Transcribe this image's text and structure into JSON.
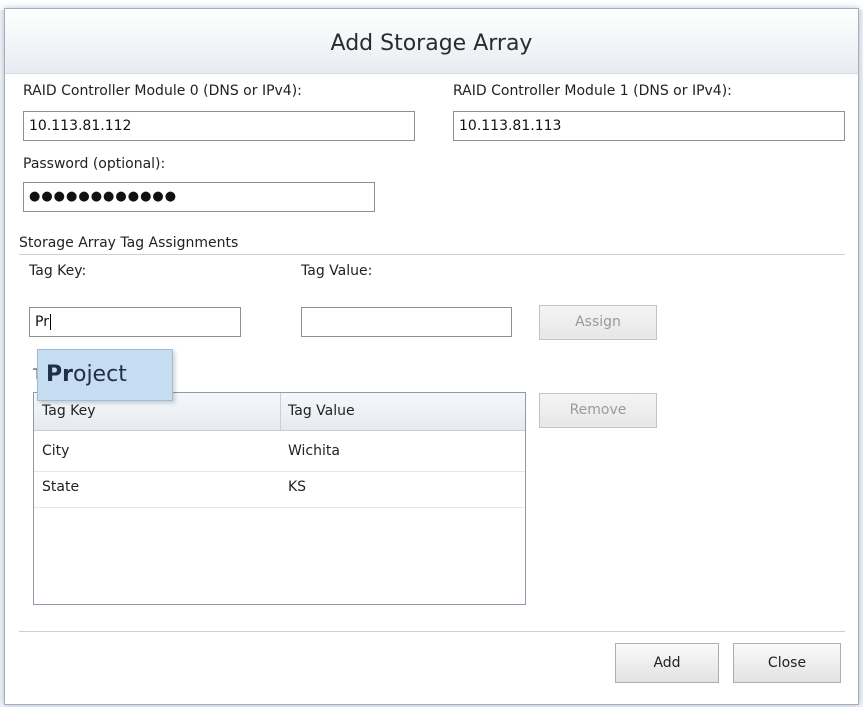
{
  "dialog": {
    "title": "Add Storage Array"
  },
  "controller0": {
    "label": "RAID Controller Module 0 (DNS or IPv4):",
    "value": "10.113.81.112"
  },
  "controller1": {
    "label": "RAID Controller Module 1 (DNS or IPv4):",
    "value": "10.113.81.113"
  },
  "password": {
    "label": "Password (optional):",
    "value": "●●●●●●●●●●●●"
  },
  "tags": {
    "section_label": "Storage Array Tag Assignments",
    "key_label": "Tag Key:",
    "value_label": "Tag Value:",
    "key_input": "Pr",
    "value_input": "",
    "assign_label": "Assign",
    "remove_label": "Remove",
    "autocomplete": {
      "match": "Pr",
      "rest": "oject"
    },
    "table": {
      "columns": [
        "Tag Key",
        "Tag Value"
      ],
      "rows": [
        [
          "City",
          "Wichita"
        ],
        [
          "State",
          "KS"
        ]
      ]
    }
  },
  "footer": {
    "add_label": "Add",
    "close_label": "Close"
  }
}
